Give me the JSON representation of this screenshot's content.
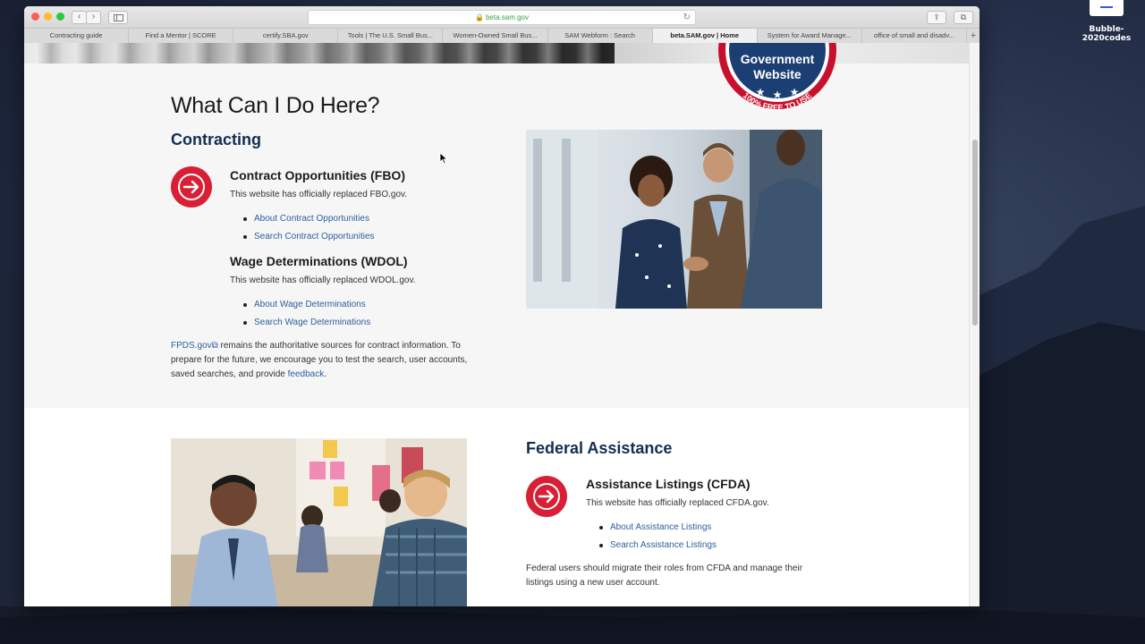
{
  "browser": {
    "url": "beta.sam.gov",
    "tabs": [
      "Contracting guide",
      "Find a Mentor | SCORE",
      "certify.SBA.gov",
      "Tools | The U.S. Small Bus...",
      "Women-Owned Small Bus...",
      "SAM Webform : Search",
      "beta.SAM.gov | Home",
      "System for Award Manage...",
      "office of small and disadv..."
    ],
    "active_tab_index": 6,
    "add_tab_label": "+",
    "back_label": "‹",
    "forward_label": "›"
  },
  "desktop": {
    "icon_label": "Bubble-2020codes"
  },
  "badge": {
    "line1": "Government",
    "line2": "Website",
    "ribbon": "100% FREE TO USE"
  },
  "page": {
    "heading": "What Can I Do Here?",
    "contracting": {
      "title": "Contracting",
      "fbo": {
        "title": "Contract Opportunities (FBO)",
        "desc": "This website has officially replaced FBO.gov.",
        "links": [
          "About Contract Opportunities",
          "Search Contract Opportunities"
        ]
      },
      "wdol": {
        "title": "Wage Determinations (WDOL)",
        "desc": "This website has officially replaced WDOL.gov.",
        "links": [
          "About Wage Determinations",
          "Search Wage Determinations"
        ]
      },
      "note_link": "FPDS.gov",
      "note_text1": " remains the authoritative sources for contract information. To",
      "note_text2": "prepare for the future, we encourage you to test the search, user accounts,",
      "note_text3": "saved searches, and provide ",
      "note_feedback": "feedback",
      "note_end": "."
    },
    "assistance": {
      "title": "Federal Assistance",
      "cfda": {
        "title": "Assistance Listings (CFDA)",
        "desc": "This website has officially replaced CFDA.gov.",
        "links": [
          "About Assistance Listings",
          "Search Assistance Listings"
        ]
      },
      "note1": "Federal users should migrate their roles from CFDA and manage their",
      "note2": "listings using a new user account."
    }
  },
  "colors": {
    "accent_red": "#d91f35",
    "heading_navy": "#112e51",
    "link_blue": "#2b5f9e"
  }
}
